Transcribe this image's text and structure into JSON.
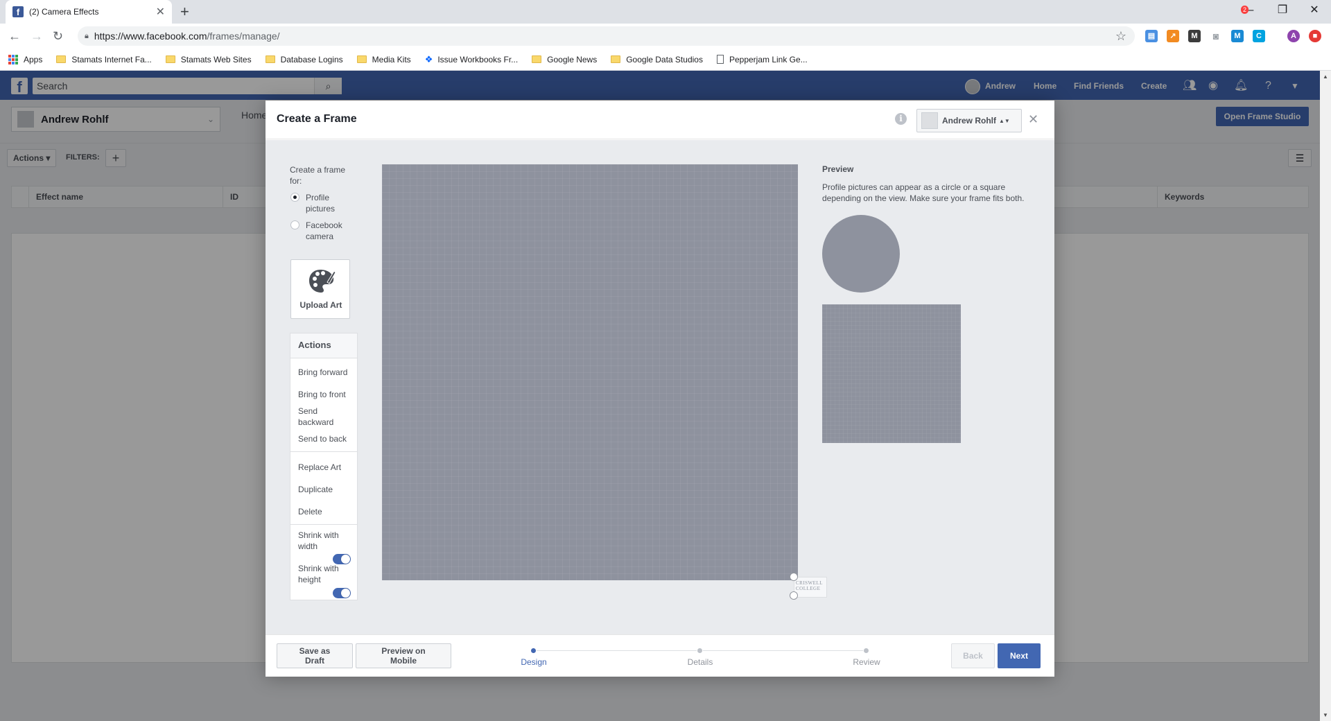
{
  "browser": {
    "tab_title": "(2) Camera Effects",
    "url_host": "https://www.facebook.com",
    "url_path": "/frames/manage/",
    "bookmarks": [
      {
        "label": "Apps",
        "icon": "apps-grid-icon"
      },
      {
        "label": "Stamats Internet Fa...",
        "icon": "folder-icon"
      },
      {
        "label": "Stamats Web Sites",
        "icon": "folder-icon"
      },
      {
        "label": "Database Logins",
        "icon": "folder-icon"
      },
      {
        "label": "Media Kits",
        "icon": "folder-icon"
      },
      {
        "label": "Issue Workbooks Fr...",
        "icon": "dropbox-icon"
      },
      {
        "label": "Google News",
        "icon": "folder-icon"
      },
      {
        "label": "Google Data Studios",
        "icon": "folder-icon"
      },
      {
        "label": "Pepperjam Link Ge...",
        "icon": "page-icon"
      }
    ]
  },
  "fb_header": {
    "search_placeholder": "Search",
    "user_name": "Andrew",
    "nav": [
      "Home",
      "Find Friends",
      "Create"
    ],
    "notification_count": "2",
    "brand_color": "#4267b2"
  },
  "page": {
    "page_name": "Andrew Rohlf",
    "home_link": "Home",
    "open_studio": "Open Frame Studio",
    "actions_label": "Actions",
    "filters_label": "FILTERS:",
    "columns": [
      "Effect name",
      "ID",
      "Keywords"
    ]
  },
  "modal": {
    "title": "Create a Frame",
    "owner_name": "Andrew Rohlf",
    "create_for_label": "Create a frame for:",
    "options": [
      {
        "label": "Profile pictures",
        "selected": true
      },
      {
        "label": "Facebook camera",
        "selected": false
      }
    ],
    "upload_art": "Upload Art",
    "actions_header": "Actions",
    "actions": {
      "bring_forward": "Bring forward",
      "bring_to_front": "Bring to front",
      "send_backward": "Send backward",
      "send_to_back": "Send to back",
      "replace_art": "Replace Art",
      "duplicate": "Duplicate",
      "delete": "Delete",
      "shrink_width": "Shrink with width",
      "shrink_height": "Shrink with height"
    },
    "toggles": {
      "shrink_width": true,
      "shrink_height": true
    },
    "art_thumb_text": "CRISWELL COLLEGE",
    "preview_label": "Preview",
    "preview_desc": "Profile pictures can appear as a circle or a square depending on the view. Make sure your frame fits both.",
    "footer": {
      "save_draft": "Save as Draft",
      "preview_mobile": "Preview on Mobile",
      "steps": [
        {
          "label": "Design",
          "active": true
        },
        {
          "label": "Details",
          "active": false
        },
        {
          "label": "Review",
          "active": false
        }
      ],
      "back": "Back",
      "next": "Next"
    }
  }
}
